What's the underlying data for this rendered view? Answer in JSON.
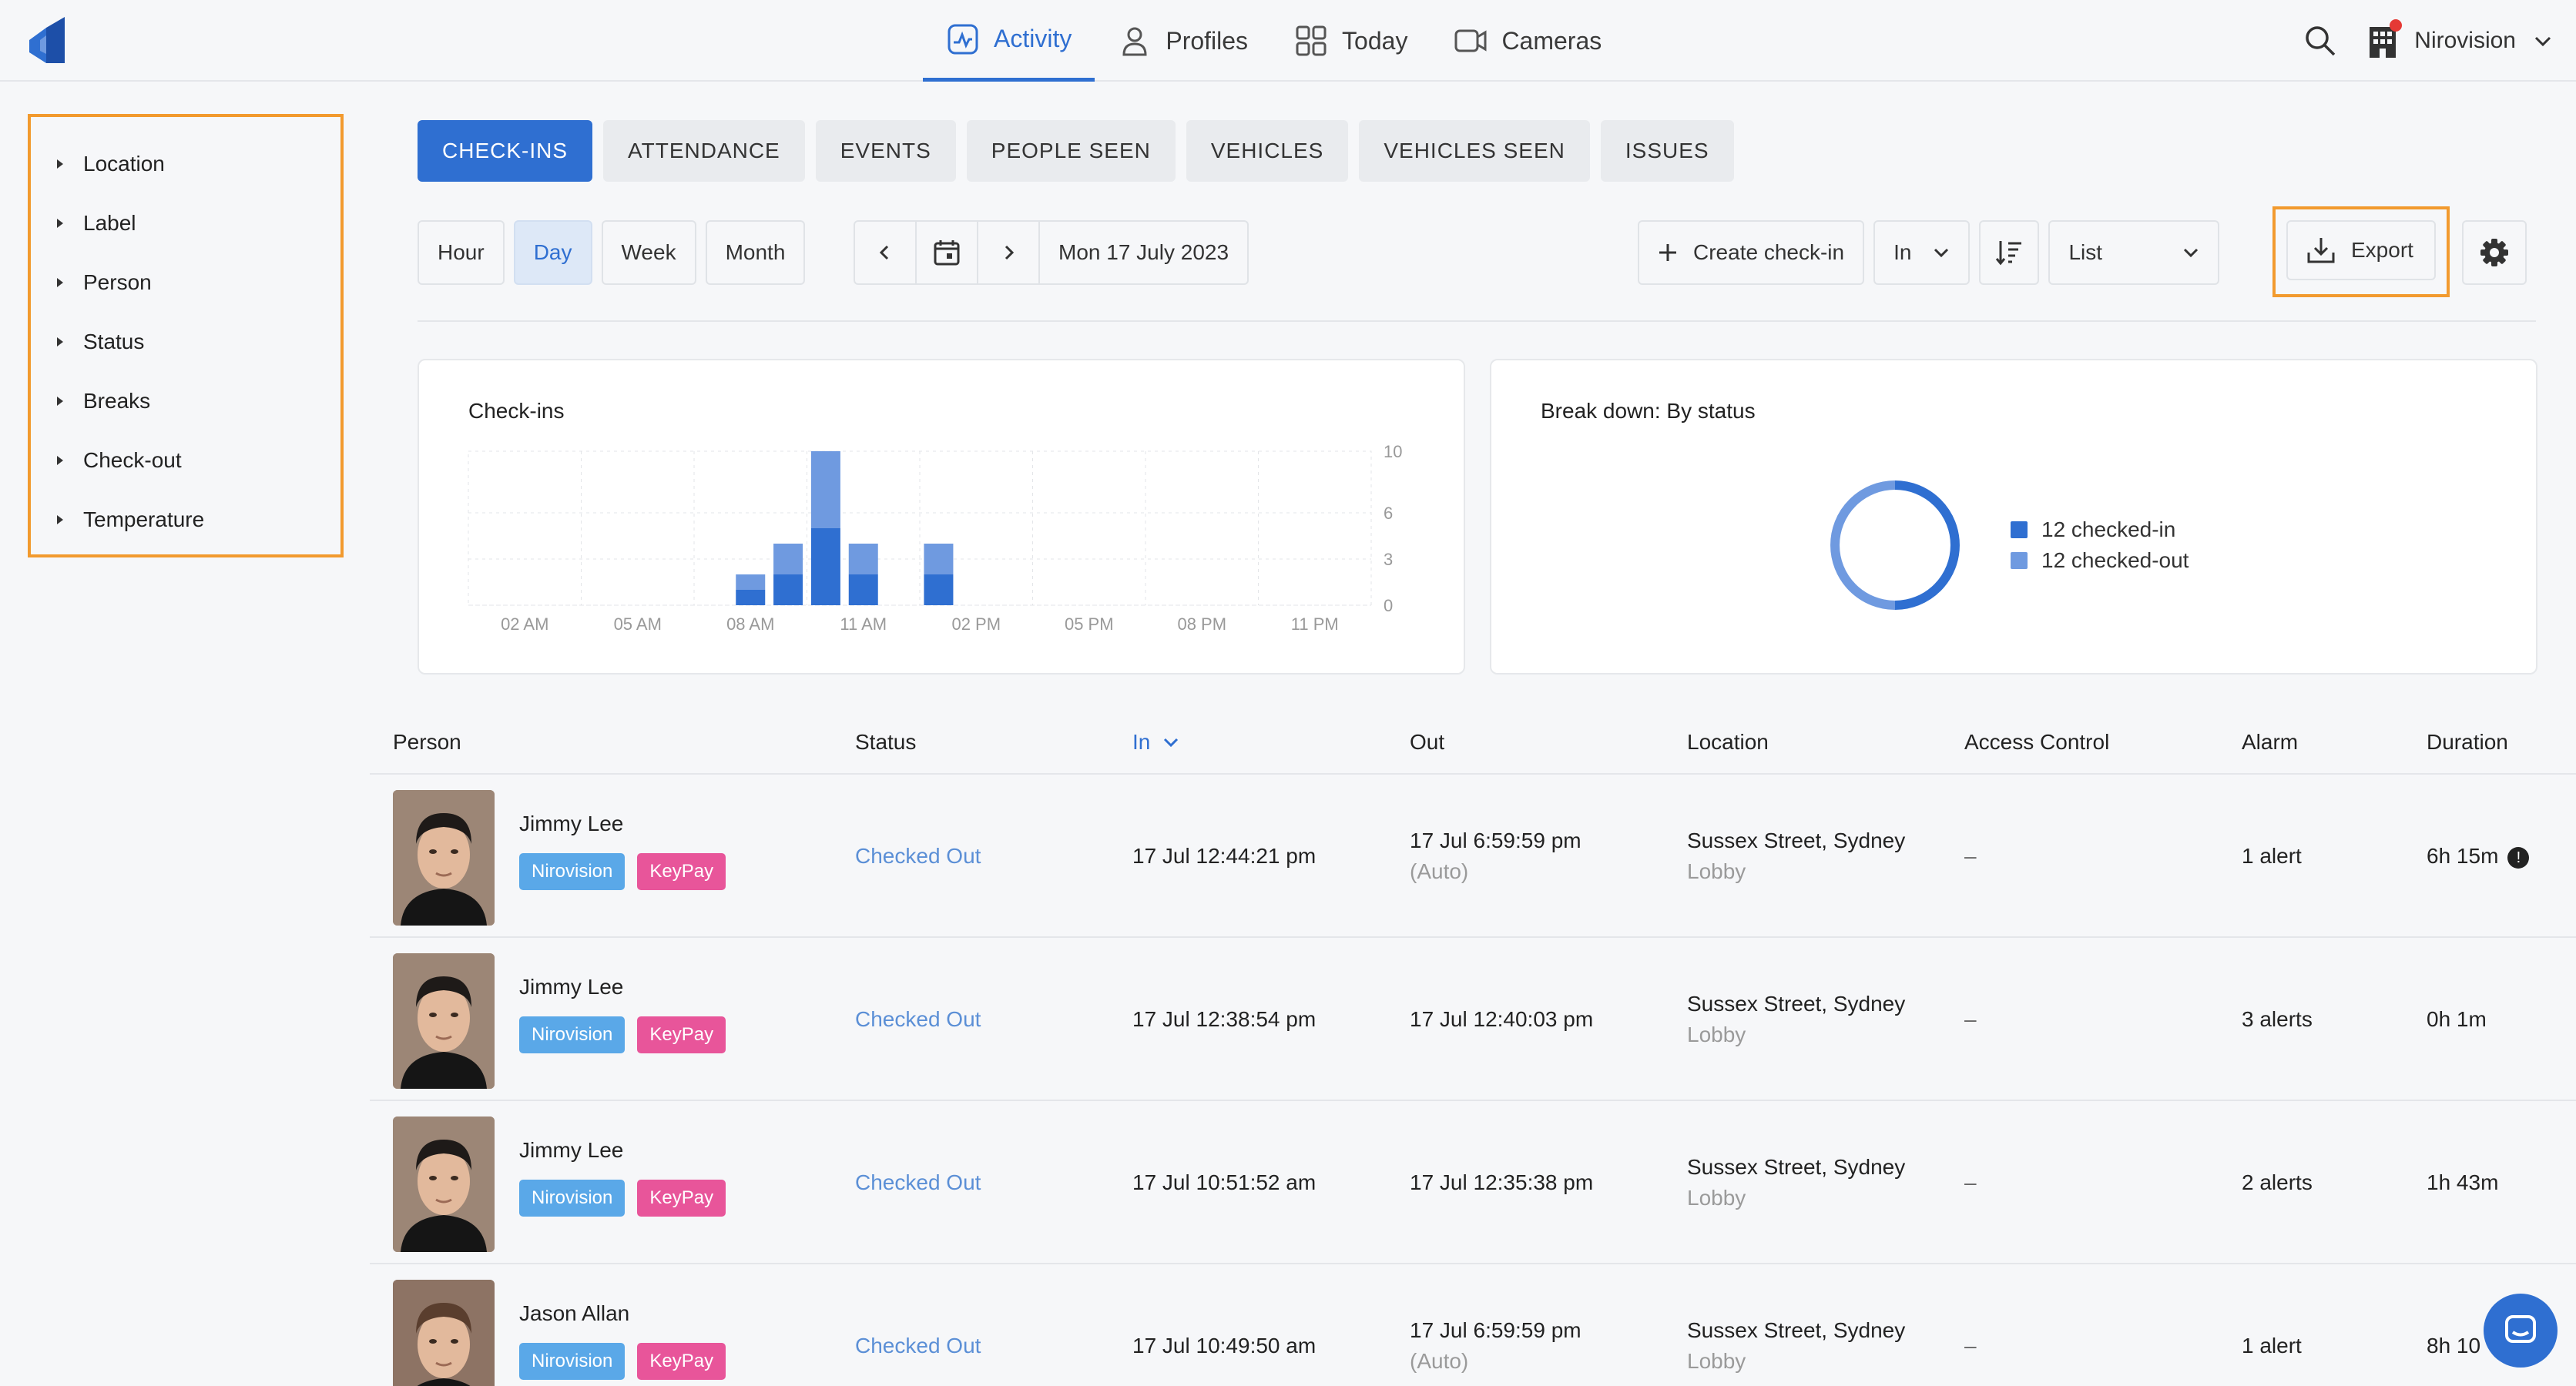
{
  "nav": {
    "items": [
      {
        "label": "Activity",
        "icon": "activity-icon",
        "active": true
      },
      {
        "label": "Profiles",
        "icon": "person-icon"
      },
      {
        "label": "Today",
        "icon": "grid-icon"
      },
      {
        "label": "Cameras",
        "icon": "camera-icon"
      }
    ],
    "org_name": "Nirovision"
  },
  "filters": [
    "Location",
    "Label",
    "Person",
    "Status",
    "Breaks",
    "Check-out",
    "Temperature"
  ],
  "tabs": [
    "CHECK-INS",
    "ATTENDANCE",
    "EVENTS",
    "PEOPLE SEEN",
    "VEHICLES",
    "VEHICLES SEEN",
    "ISSUES"
  ],
  "toolbar": {
    "ranges": [
      "Hour",
      "Day",
      "Week",
      "Month"
    ],
    "selected_range": "Day",
    "date": "Mon 17 July 2023",
    "create_label": "Create check-in",
    "direction_select": "In",
    "view_select": "List",
    "export_label": "Export"
  },
  "checkins_card": {
    "title": "Check-ins"
  },
  "breakdown_card": {
    "title": "Break down: By status"
  },
  "chart_data": [
    {
      "type": "bar",
      "title": "Check-ins",
      "x_tick_labels": [
        "02 AM",
        "05 AM",
        "08 AM",
        "11 AM",
        "02 PM",
        "05 PM",
        "08 PM",
        "11 PM"
      ],
      "y_tick_labels": [
        "10",
        "6",
        "3",
        "0"
      ],
      "ylim": [
        0,
        10
      ],
      "stacked": true,
      "series": [
        {
          "name": "checked-in",
          "color": "#2f6fd1",
          "hour_values": {
            "7": 1,
            "8": 2,
            "9": 5,
            "10": 2,
            "12": 2
          }
        },
        {
          "name": "checked-out",
          "color": "#6f9ae0",
          "hour_values": {
            "7": 1,
            "8": 2,
            "9": 5,
            "10": 2,
            "12": 2
          }
        }
      ],
      "grid": true
    },
    {
      "type": "pie",
      "title": "Break down: By status",
      "categories": [
        "checked-in",
        "checked-out"
      ],
      "values": [
        12,
        12
      ],
      "colors": [
        "#2f6fd1",
        "#6f9ae0"
      ],
      "legend": [
        "12 checked-in",
        "12 checked-out"
      ]
    }
  ],
  "table": {
    "headers": [
      "Person",
      "Status",
      "In",
      "Out",
      "Location",
      "Access Control",
      "Alarm",
      "Duration"
    ],
    "rows": [
      {
        "name": "Jimmy Lee",
        "badges": [
          "Nirovision",
          "KeyPay"
        ],
        "status": "Checked Out",
        "in": "17 Jul 12:44:21 pm",
        "out": "17 Jul 6:59:59 pm",
        "out_note": "(Auto)",
        "location": "Sussex Street, Sydney",
        "sublocation": "Lobby",
        "access": "–",
        "alarm": "1 alert",
        "duration": "6h 15m",
        "info": "!"
      },
      {
        "name": "Jimmy Lee",
        "badges": [
          "Nirovision",
          "KeyPay"
        ],
        "status": "Checked Out",
        "in": "17 Jul 12:38:54 pm",
        "out": "17 Jul 12:40:03 pm",
        "out_note": "",
        "location": "Sussex Street, Sydney",
        "sublocation": "Lobby",
        "access": "–",
        "alarm": "3 alerts",
        "duration": "0h 1m",
        "info": ""
      },
      {
        "name": "Jimmy Lee",
        "badges": [
          "Nirovision",
          "KeyPay"
        ],
        "status": "Checked Out",
        "in": "17 Jul 10:51:52 am",
        "out": "17 Jul 12:35:38 pm",
        "out_note": "",
        "location": "Sussex Street, Sydney",
        "sublocation": "Lobby",
        "access": "–",
        "alarm": "2 alerts",
        "duration": "1h 43m",
        "info": ""
      },
      {
        "name": "Jason Allan",
        "badges": [
          "Nirovision",
          "KeyPay"
        ],
        "status": "Checked Out",
        "in": "17 Jul 10:49:50 am",
        "out": "17 Jul 6:59:59 pm",
        "out_note": "(Auto)",
        "location": "Sussex Street, Sydney",
        "sublocation": "Lobby",
        "access": "–",
        "alarm": "1 alert",
        "duration": "8h 10",
        "info": ""
      }
    ]
  }
}
